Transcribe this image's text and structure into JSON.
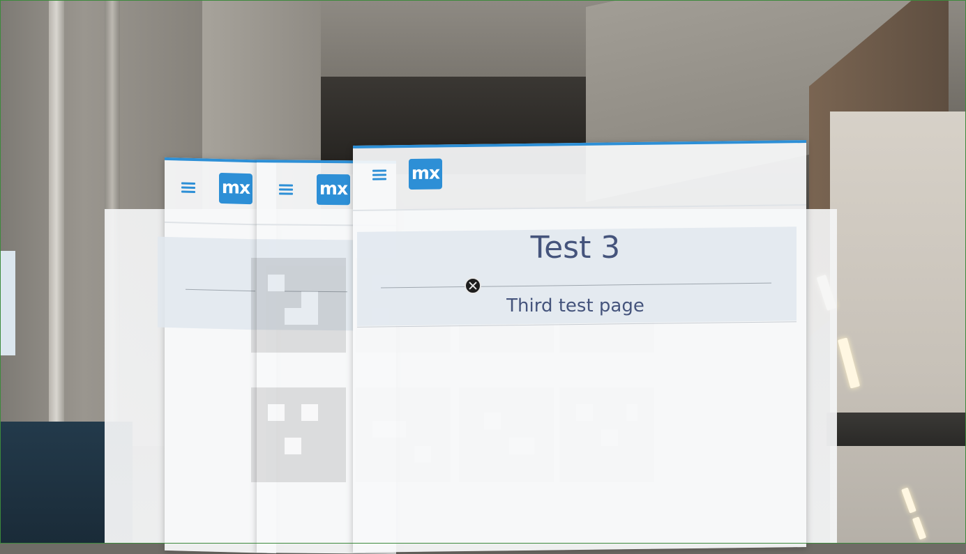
{
  "windows": [
    {
      "logo_text": "mx"
    },
    {
      "logo_text": "mx"
    },
    {
      "logo_text": "mx",
      "title": "Test 3",
      "subtitle": "Third test page"
    }
  ],
  "colors": {
    "accent": "#2d8fd6",
    "title_text": "#45547c",
    "window_bg": "#f8f9fa"
  },
  "icons": {
    "menu": "hamburger-menu-icon",
    "cursor": "gaze-cursor-icon"
  }
}
